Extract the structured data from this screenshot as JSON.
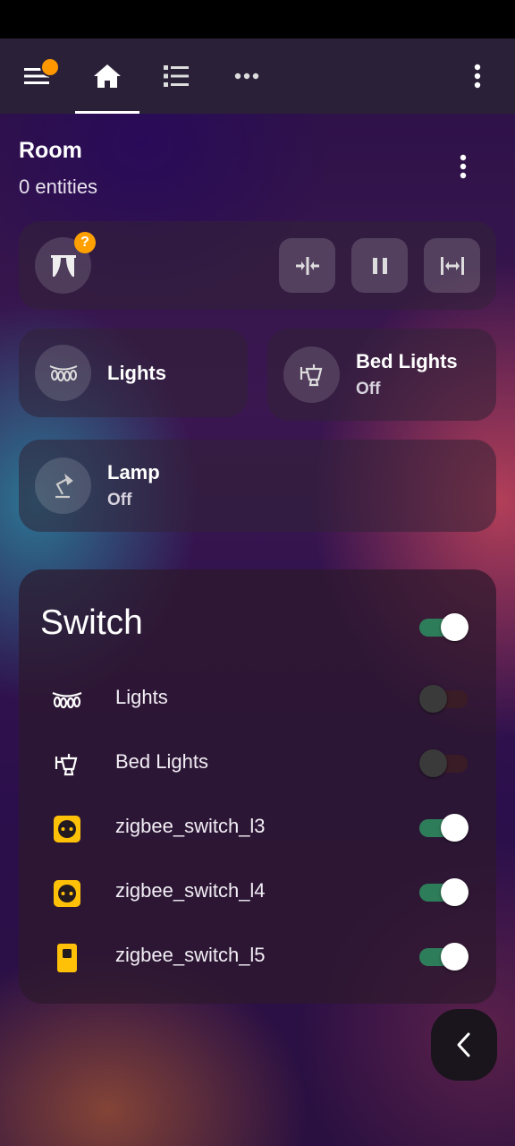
{
  "topbar": {
    "icons": [
      "menu-icon",
      "home-icon",
      "list-icon",
      "more-horizontal-icon",
      "more-vertical-icon"
    ],
    "notification_color": "#ff9800"
  },
  "room": {
    "title": "Room",
    "subtitle": "0 entities"
  },
  "cover": {
    "icon": "curtains-icon",
    "badge": "?",
    "buttons": [
      "close-cover-icon",
      "pause-icon",
      "open-cover-icon"
    ]
  },
  "tiles": {
    "lights": {
      "name": "Lights",
      "icon": "string-lights-icon"
    },
    "bed_lights": {
      "name": "Bed Lights",
      "state": "Off",
      "icon": "outdoor-lamp-icon"
    },
    "lamp": {
      "name": "Lamp",
      "state": "Off",
      "icon": "desk-lamp-icon"
    }
  },
  "switch_card": {
    "title": "Switch",
    "master_on": true,
    "rows": [
      {
        "label": "Lights",
        "icon": "string-lights-icon",
        "on": false
      },
      {
        "label": "Bed Lights",
        "icon": "outdoor-lamp-icon",
        "on": false
      },
      {
        "label": "zigbee_switch_l3",
        "icon": "power-socket-icon",
        "on": true
      },
      {
        "label": "zigbee_switch_l4",
        "icon": "power-socket-icon",
        "on": true
      },
      {
        "label": "zigbee_switch_l5",
        "icon": "light-switch-icon",
        "on": true
      }
    ]
  },
  "colors": {
    "accent_on": "#2e7d5a",
    "socket_yellow": "#ffc107",
    "badge_orange": "#ffa000"
  }
}
